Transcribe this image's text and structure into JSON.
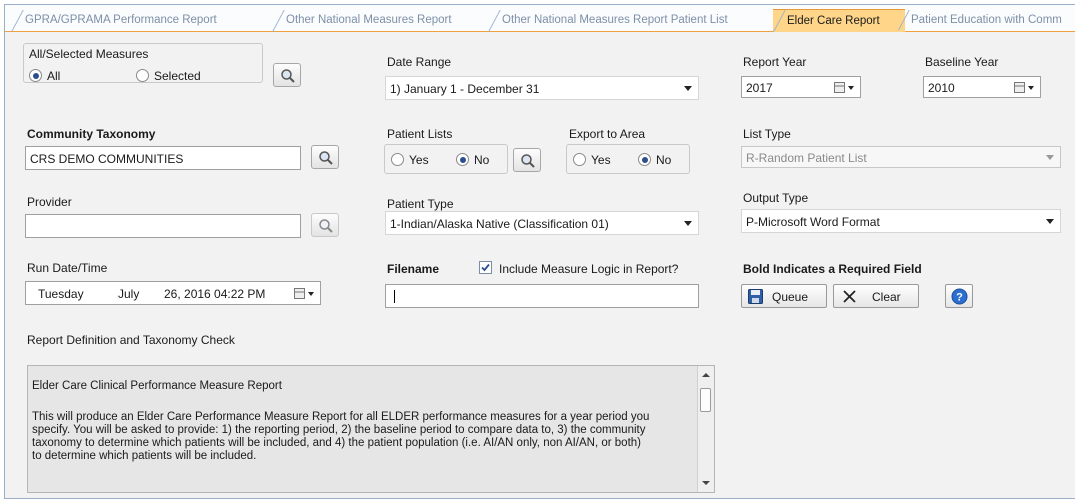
{
  "tabs": [
    {
      "label": "GPRA/GPRAMA Performance Report",
      "active": false
    },
    {
      "label": "Other National Measures Report",
      "active": false
    },
    {
      "label": "Other National Measures Report Patient List",
      "active": false
    },
    {
      "label": "Elder Care Report",
      "active": true
    },
    {
      "label": "Patient Education with Comm",
      "active": false
    }
  ],
  "measures": {
    "legend": "All/Selected Measures",
    "opt_all": "All",
    "opt_selected": "Selected",
    "selected": "All"
  },
  "date_range": {
    "label": "Date Range",
    "value": "1) January 1 - December 31"
  },
  "report_year": {
    "label": "Report Year",
    "value": "2017"
  },
  "baseline_year": {
    "label": "Baseline Year",
    "value": "2010"
  },
  "community": {
    "label": "Community Taxonomy",
    "value": "CRS DEMO COMMUNITIES"
  },
  "patient_lists": {
    "label": "Patient Lists",
    "yes": "Yes",
    "no": "No",
    "selected": "No"
  },
  "export_area": {
    "label": "Export to Area",
    "yes": "Yes",
    "no": "No",
    "selected": "No"
  },
  "list_type": {
    "label": "List Type",
    "value": "R-Random Patient List",
    "enabled": false
  },
  "provider": {
    "label": "Provider",
    "value": ""
  },
  "patient_type": {
    "label": "Patient Type",
    "value": "1-Indian/Alaska Native (Classification 01)"
  },
  "output_type": {
    "label": "Output Type",
    "value": "P-Microsoft Word Format"
  },
  "run_datetime": {
    "label": "Run Date/Time",
    "weekday": "Tuesday",
    "month": "July",
    "rest": "26, 2016 04:22 PM"
  },
  "filename": {
    "label": "Filename",
    "value": "",
    "include_logic_label": "Include Measure Logic in Report?",
    "include_logic_checked": true
  },
  "required_note": "Bold Indicates a Required Field",
  "buttons": {
    "queue": "Queue",
    "clear": "Clear"
  },
  "definition": {
    "label": "Report Definition and Taxonomy Check",
    "title": "Elder Care Clinical Performance Measure Report",
    "body_lines": [
      "This will produce an Elder Care Performance Measure Report for all ELDER performance measures for a year period you",
      "specify.  You will be asked to provide: 1) the reporting period, 2) the baseline period to compare data to, 3) the community",
      "taxonomy to determine which patients will be included, and 4) the patient population (i.e. AI/AN only, non AI/AN, or both)",
      "to determine which patients will be included."
    ]
  },
  "colors": {
    "accent_tab": "#ffd58a",
    "tab_border": "#f29f3d",
    "radio_dot": "#2b4f8c",
    "help_blue": "#2c6fcf"
  }
}
